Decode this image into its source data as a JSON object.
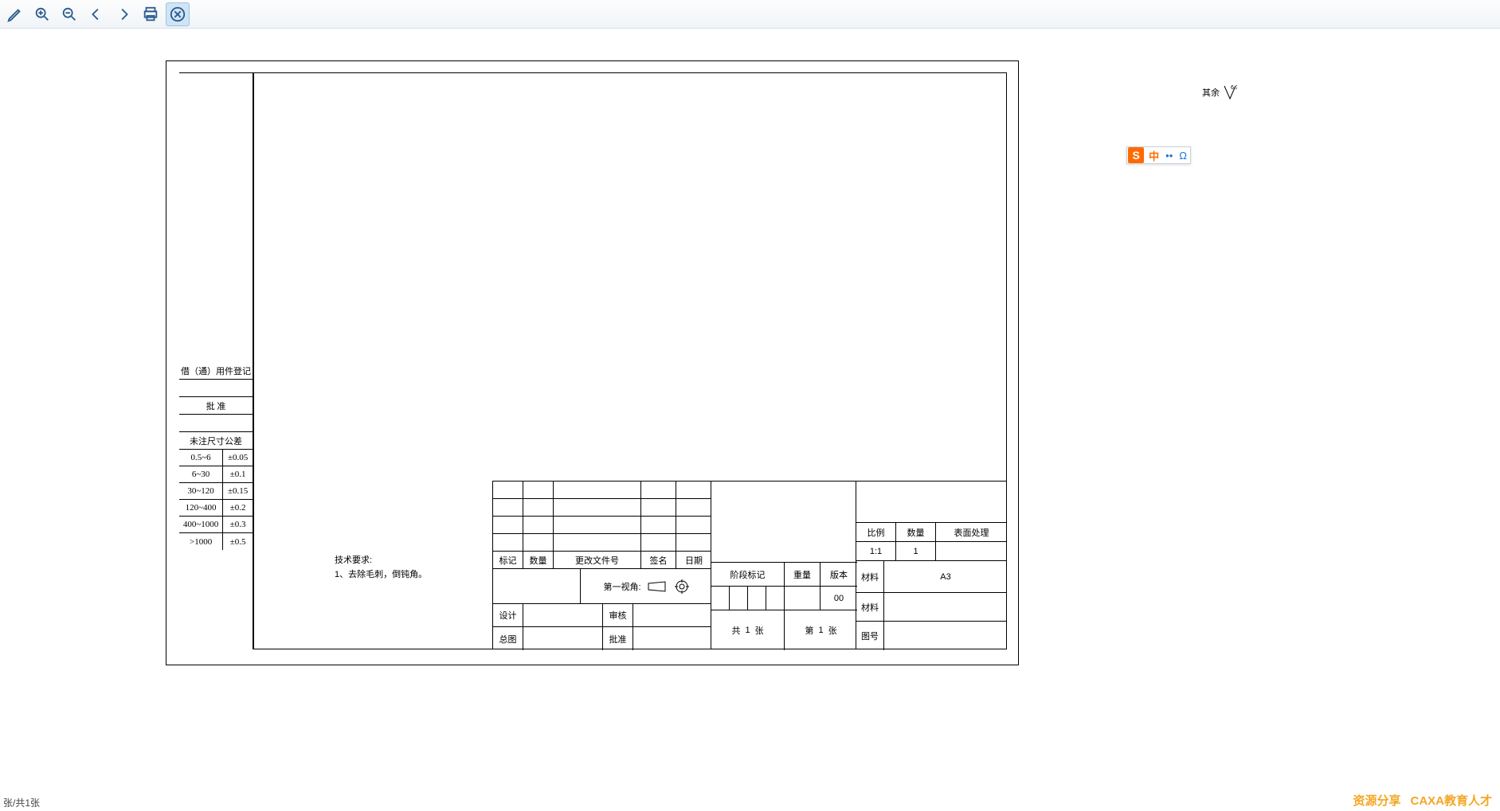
{
  "toolbar": {
    "icons": [
      "pencil",
      "zoom-in",
      "zoom-fit",
      "back",
      "forward",
      "print",
      "close"
    ]
  },
  "ime": {
    "brand": "S",
    "mode": "中",
    "punct": "••",
    "omega": "Ω"
  },
  "status": {
    "text": "张/共1张"
  },
  "watermark": {
    "left": "资源分享",
    "right": "CAXA教育人才"
  },
  "surface": {
    "label": "其余",
    "value": "6.3"
  },
  "revision": {
    "borrow": "借（通）用件登记",
    "approve": "批 准",
    "tolerance_title": "未注尺寸公差",
    "rows": [
      {
        "range": "0.5~6",
        "tol": "±0.05"
      },
      {
        "range": "6~30",
        "tol": "±0.1"
      },
      {
        "range": "30~120",
        "tol": "±0.15"
      },
      {
        "range": "120~400",
        "tol": "±0.2"
      },
      {
        "range": "400~1000",
        "tol": "±0.3"
      },
      {
        "range": ">1000",
        "tol": "±0.5"
      }
    ]
  },
  "tech": {
    "title": "技术要求:",
    "line1": "1、去除毛刺，倒钝角。"
  },
  "revblock": {
    "hdr": {
      "mark": "标记",
      "num": "数量",
      "doc": "更改文件号",
      "sign": "签名",
      "date": "日期"
    },
    "proj": {
      "label": "第一视角:"
    },
    "roles": {
      "design": "设计",
      "check": "审核",
      "stdchk": "总图",
      "process": "批准"
    }
  },
  "stage": {
    "label": "阶段标记",
    "weight": "重量",
    "scale": "版本",
    "ver": "00",
    "sheet_total_l": "共",
    "sheet_total_n": "1",
    "sheet_total_r": "张",
    "sheet_cur_l": "第",
    "sheet_cur_n": "1",
    "sheet_cur_r": "张"
  },
  "title": {
    "scale_l": "比例",
    "qty_l": "数量",
    "surf_l": "表面处理",
    "scale_v": "1:1",
    "qty_v": "1",
    "mat": "材料",
    "size": "A3",
    "no": "图号"
  }
}
